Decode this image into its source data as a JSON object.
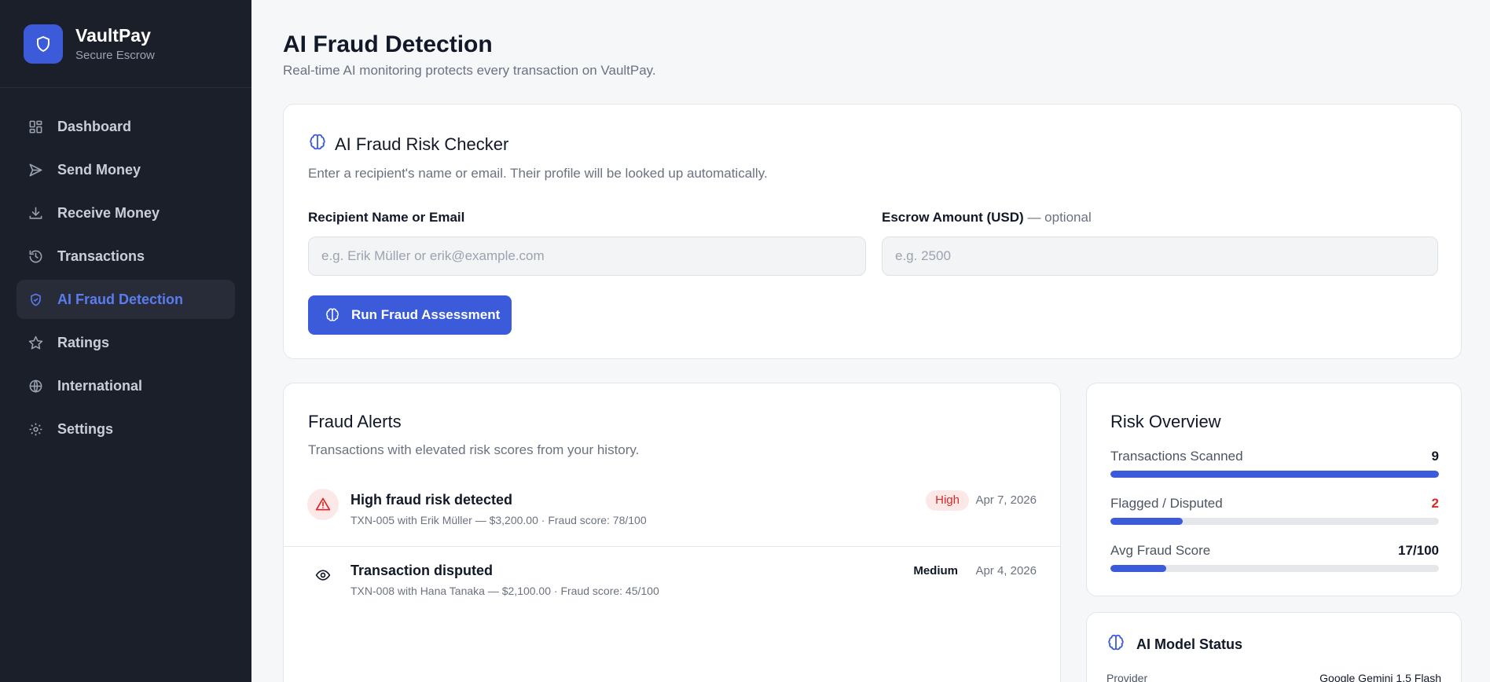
{
  "brand": {
    "name": "VaultPay",
    "subtitle": "Secure Escrow"
  },
  "sidebar": {
    "items": [
      {
        "label": "Dashboard",
        "icon": "dashboard-icon",
        "active": false
      },
      {
        "label": "Send Money",
        "icon": "send-icon",
        "active": false
      },
      {
        "label": "Receive Money",
        "icon": "download-icon",
        "active": false
      },
      {
        "label": "Transactions",
        "icon": "history-icon",
        "active": false
      },
      {
        "label": "AI Fraud Detection",
        "icon": "shield-check-icon",
        "active": true
      },
      {
        "label": "Ratings",
        "icon": "star-icon",
        "active": false
      },
      {
        "label": "International",
        "icon": "globe-icon",
        "active": false
      },
      {
        "label": "Settings",
        "icon": "gear-icon",
        "active": false
      }
    ]
  },
  "header": {
    "title": "AI Fraud Detection",
    "subtitle": "Real-time AI monitoring protects every transaction on VaultPay."
  },
  "checker": {
    "title": "AI Fraud Risk Checker",
    "subtitle": "Enter a recipient's name or email. Their profile will be looked up automatically.",
    "recipient_label": "Recipient Name or Email",
    "recipient_placeholder": "e.g. Erik Müller or erik@example.com",
    "recipient_value": "",
    "amount_label": "Escrow Amount (USD)",
    "amount_optional": "— optional",
    "amount_placeholder": "e.g. 2500",
    "amount_value": "",
    "run_button": "Run Fraud Assessment"
  },
  "alerts": {
    "title": "Fraud Alerts",
    "subtitle": "Transactions with elevated risk scores from your history.",
    "items": [
      {
        "title": "High fraud risk detected",
        "description": "TXN-005 with Erik Müller — $3,200.00 · Fraud score: 78/100",
        "severity": "High",
        "date": "Apr 7, 2026",
        "icon": "alert-triangle-icon"
      },
      {
        "title": "Transaction disputed",
        "description": "TXN-008 with Hana Tanaka — $2,100.00 · Fraud score: 45/100",
        "severity": "Medium",
        "date": "Apr 4, 2026",
        "icon": "eye-icon"
      }
    ]
  },
  "risk": {
    "title": "Risk Overview",
    "metrics": [
      {
        "label": "Transactions Scanned",
        "value": "9",
        "fill_percent": 100
      },
      {
        "label": "Flagged / Disputed",
        "value": "2",
        "fill_percent": 22
      },
      {
        "label": "Avg Fraud Score",
        "value": "17/100",
        "fill_percent": 17
      }
    ]
  },
  "model": {
    "title": "AI Model Status",
    "provider_label": "Provider",
    "provider_value": "Google Gemini 1.5 Flash"
  },
  "colors": {
    "sidebar_bg": "#1b1f2a",
    "accent": "#3b5bdb",
    "active_nav_text": "#5b7cf0",
    "danger": "#dc2626",
    "page_bg": "#f6f7f9"
  }
}
